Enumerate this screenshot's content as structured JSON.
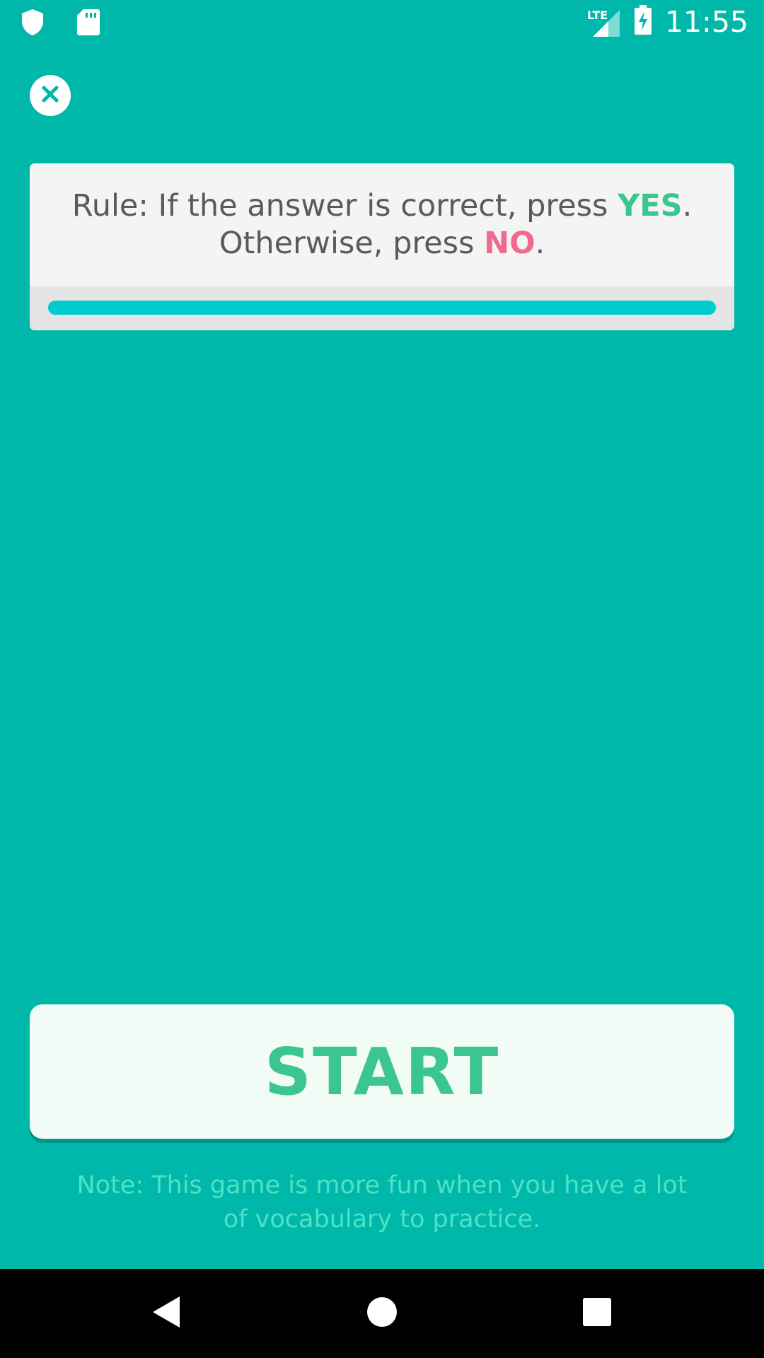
{
  "status_bar": {
    "time": "11:55",
    "network_label": "LTE",
    "icons": [
      "shield-icon",
      "sd-card-icon",
      "lte-signal-icon",
      "battery-charging-icon"
    ]
  },
  "close_button": {
    "icon": "close-icon"
  },
  "rule": {
    "prefix": "Rule: If the answer is correct, press ",
    "yes": "YES",
    "period1": ".",
    "line2_prefix": "Otherwise, press ",
    "no": "NO",
    "period2": ".",
    "yes_color": "#3CC68F",
    "no_color": "#F06A8E"
  },
  "timer": {
    "progress_fraction": 1.0,
    "color": "#00CCD0"
  },
  "start_button": {
    "label": "START"
  },
  "note": "Note: This game is more fun when you have a lot of vocabulary to practice.",
  "nav": {
    "icons": [
      "back-icon",
      "home-icon",
      "recents-icon"
    ]
  },
  "colors": {
    "background": "#00B8AA",
    "card": "#F4F4F4",
    "start_text": "#3CC68F"
  }
}
